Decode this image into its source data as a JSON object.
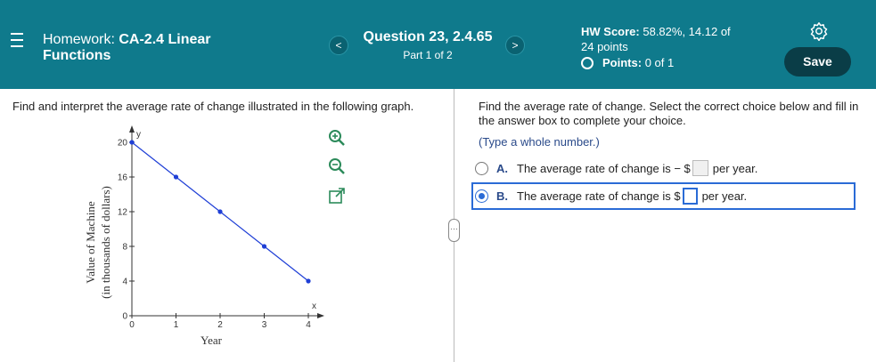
{
  "header": {
    "hw_label": "Homework:",
    "hw_name_line1": "CA-2.4 Linear",
    "hw_name_line2": "Functions",
    "question_title": "Question 23, 2.4.65",
    "question_part": "Part 1 of 2",
    "score_label": "HW Score:",
    "score_value": "58.82%, 14.12 of",
    "score_total": "24 points",
    "points_label": "Points:",
    "points_value": "0 of 1",
    "save_label": "Save",
    "prev_glyph": "<",
    "next_glyph": ">",
    "bg_color": "#0f7a8c"
  },
  "left": {
    "prompt": "Find and interpret the average rate of change illustrated in the following graph.",
    "tools": [
      "zoom-in-icon",
      "zoom-out-icon",
      "popout-icon"
    ]
  },
  "chart_data": {
    "type": "line",
    "x": [
      0,
      1,
      2,
      3,
      4
    ],
    "series": [
      {
        "values": [
          20,
          16,
          12,
          8,
          4
        ]
      }
    ],
    "xlabel": "Year",
    "ylabel_line1": "Value of Machine",
    "ylabel_line2": "(in thousands of dollars)",
    "x_axis_letter": "x",
    "y_axis_letter": "y",
    "xticks": [
      0,
      1,
      2,
      3,
      4
    ],
    "yticks": [
      0,
      4,
      8,
      12,
      16,
      20
    ],
    "xlim": [
      0,
      4
    ],
    "ylim": [
      0,
      20
    ],
    "line_color": "#1f3fd6",
    "point_color": "#1f3fd6"
  },
  "right": {
    "prompt": "Find the average rate of change. Select the correct choice below and fill in the answer box to complete your choice.",
    "hint": "(Type a whole number.)",
    "choices": [
      {
        "letter": "A.",
        "text": "The average rate of change is − $",
        "suffix": "per year.",
        "selected": false
      },
      {
        "letter": "B.",
        "text": "The average rate of change is $",
        "suffix": "per year.",
        "selected": true
      }
    ],
    "accent": "#2a6bd6",
    "handle_glyph": "…"
  }
}
